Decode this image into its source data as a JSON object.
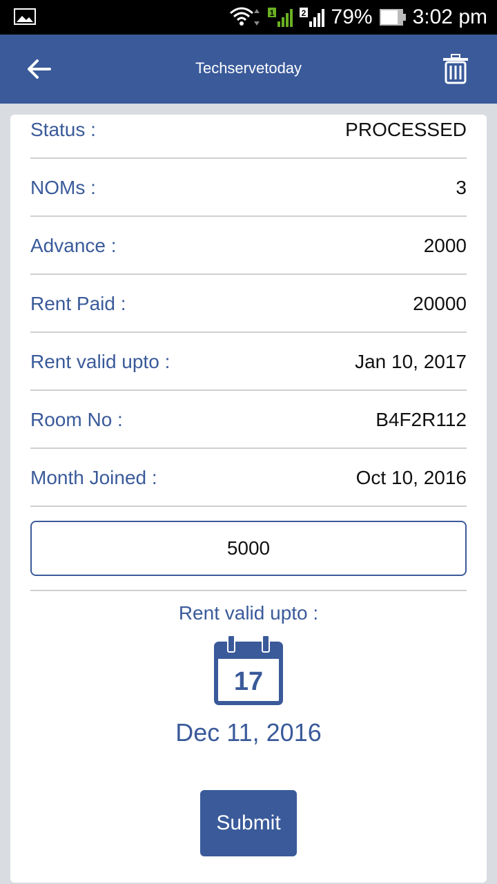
{
  "status_bar": {
    "battery": "79%",
    "time": "3:02 pm",
    "sim1": "1",
    "sim2": "2"
  },
  "app_bar": {
    "title": "Techservetoday"
  },
  "details": [
    {
      "label": "Status :",
      "value": "PROCESSED"
    },
    {
      "label": "NOMs :",
      "value": "3"
    },
    {
      "label": "Advance :",
      "value": "2000"
    },
    {
      "label": "Rent Paid :",
      "value": "20000"
    },
    {
      "label": "Rent valid upto :",
      "value": "Jan 10, 2017"
    },
    {
      "label": "Room No :",
      "value": "B4F2R112"
    },
    {
      "label": "Month Joined :",
      "value": "Oct 10, 2016"
    }
  ],
  "amount_input": {
    "value": "5000"
  },
  "rent_valid": {
    "label": "Rent valid upto :",
    "calendar_day": "17",
    "date": "Dec 11, 2016"
  },
  "submit_label": "Submit",
  "colors": {
    "primary": "#3a5a9a",
    "divider": "#cfcfcf",
    "background": "#d9dce1"
  }
}
